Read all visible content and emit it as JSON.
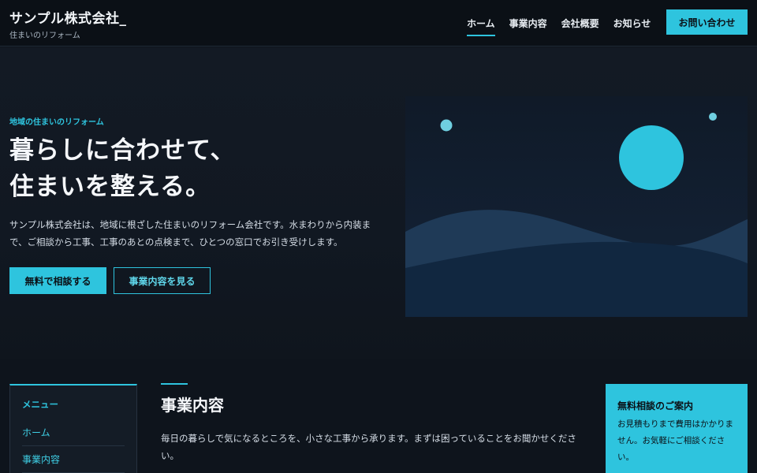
{
  "header": {
    "title": "サンプル株式会社_",
    "subtitle": "住まいのリフォーム",
    "nav": [
      "ホーム",
      "事業内容",
      "会社概要",
      "お知らせ"
    ],
    "cta_label": "お問い合わせ"
  },
  "hero": {
    "eyebrow": "地域の住まいのリフォーム",
    "headline_line1": "暮らしに合わせて、",
    "headline_line2": "住まいを整える。",
    "lead": "サンプル株式会社は、地域に根ざした住まいのリフォーム会社です。水まわりから内装まで、ご相談から工事、工事のあとの点検まで、ひとつの窓口でお引き受けします。",
    "primary_button": "無料で相談する",
    "secondary_button": "事業内容を見る"
  },
  "sidebar": {
    "title": "メニュー",
    "links": [
      "ホーム",
      "事業内容"
    ]
  },
  "section": {
    "title": "事業内容",
    "text": "毎日の暮らしで気になるところを、小さな工事から承ります。まずは困っていることをお聞かせください。"
  },
  "consult": {
    "title": "無料相談のご案内",
    "text": "お見積もりまで費用はかかりません。お気軽にご相談ください。"
  },
  "colors": {
    "accent": "#2ec4de",
    "background": "#0e141c",
    "header": "#0b1016"
  }
}
